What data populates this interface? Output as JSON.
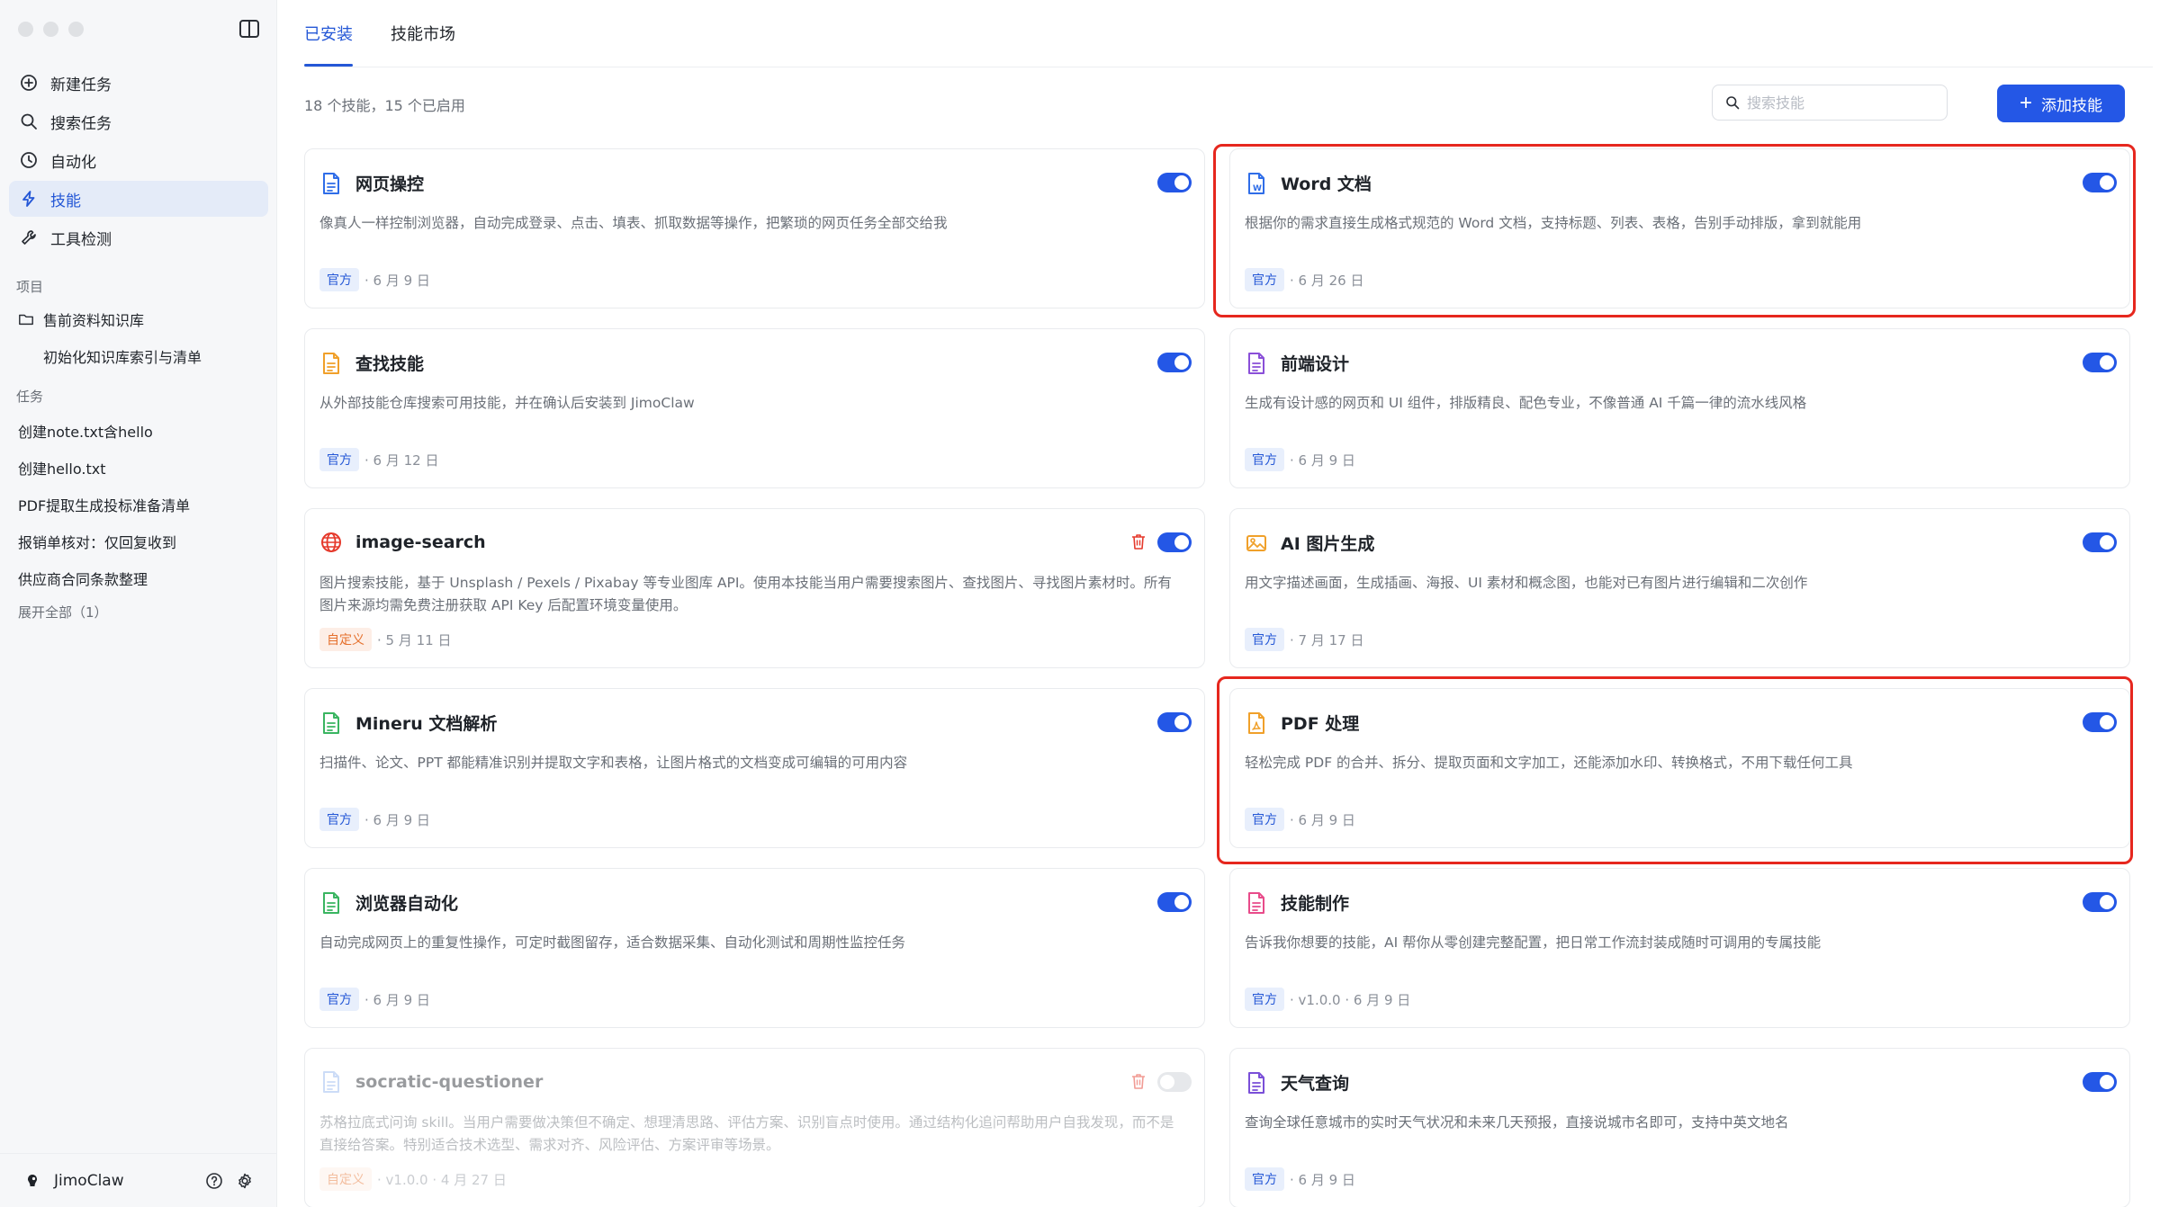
{
  "sidebar": {
    "nav": [
      {
        "label": "新建任务",
        "icon": "plus-circle-icon"
      },
      {
        "label": "搜索任务",
        "icon": "search-icon"
      },
      {
        "label": "自动化",
        "icon": "clock-icon"
      },
      {
        "label": "技能",
        "icon": "lightning-icon"
      },
      {
        "label": "工具检测",
        "icon": "wrench-icon"
      }
    ],
    "projects_label": "项目",
    "projects": [
      {
        "label": "售前资料知识库"
      },
      {
        "label": "初始化知识库索引与清单"
      }
    ],
    "tasks_label": "任务",
    "tasks": [
      {
        "label": "创建note.txt含hello"
      },
      {
        "label": "创建hello.txt"
      },
      {
        "label": "PDF提取生成投标准备清单"
      },
      {
        "label": "报销单核对：仅回复收到"
      },
      {
        "label": "供应商合同条款整理"
      }
    ],
    "expand_all": "展开全部（1）",
    "user_name": "JimoClaw"
  },
  "tabs": [
    {
      "label": "已安装"
    },
    {
      "label": "技能市场"
    }
  ],
  "summary": "18 个技能，15 个已启用",
  "search": {
    "placeholder": "搜索技能"
  },
  "add_button": {
    "label": "添加技能"
  },
  "cards": [
    {
      "title": "网页操控",
      "icon": "document-icon",
      "desc": "像真人一样控制浏览器，自动完成登录、点击、填表、抓取数据等操作，把繁琐的网页任务全部交给我",
      "badge": "官方",
      "meta": "· 6 月 9 日",
      "enabled": true
    },
    {
      "title": "Word 文档",
      "icon": "word-document-icon",
      "desc": "根据你的需求直接生成格式规范的 Word 文档，支持标题、列表、表格，告别手动排版，拿到就能用",
      "badge": "官方",
      "meta": "· 6 月 26 日",
      "enabled": true
    },
    {
      "title": "查找技能",
      "icon": "document-icon",
      "desc": "从外部技能仓库搜索可用技能，并在确认后安装到 JimoClaw",
      "badge": "官方",
      "meta": "· 6 月 12 日",
      "enabled": true
    },
    {
      "title": "前端设计",
      "icon": "document-icon",
      "desc": "生成有设计感的网页和 UI 组件，排版精良、配色专业，不像普通 AI 千篇一律的流水线风格",
      "badge": "官方",
      "meta": "· 6 月 9 日",
      "enabled": true
    },
    {
      "title": "image-search",
      "icon": "globe-icon",
      "desc": "图片搜索技能，基于 Unsplash / Pexels / Pixabay 等专业图库 API。使用本技能当用户需要搜索图片、查找图片、寻找图片素材时。所有图片来源均需免费注册获取 API Key 后配置环境变量使用。",
      "badge": "自定义",
      "meta": "· 5 月 11 日",
      "enabled": true
    },
    {
      "title": "AI 图片生成",
      "icon": "image-icon",
      "desc": "用文字描述画面，生成插画、海报、UI 素材和概念图，也能对已有图片进行编辑和二次创作",
      "badge": "官方",
      "meta": "· 7 月 17 日",
      "enabled": true
    },
    {
      "title": "Mineru 文档解析",
      "icon": "document-icon",
      "desc": "扫描件、论文、PPT 都能精准识别并提取文字和表格，让图片格式的文档变成可编辑的可用内容",
      "badge": "官方",
      "meta": "· 6 月 9 日",
      "enabled": true
    },
    {
      "title": "PDF 处理",
      "icon": "pdf-icon",
      "desc": "轻松完成 PDF 的合并、拆分、提取页面和文字加工，还能添加水印、转换格式，不用下载任何工具",
      "badge": "官方",
      "meta": "· 6 月 9 日",
      "enabled": true
    },
    {
      "title": "浏览器自动化",
      "icon": "document-icon",
      "desc": "自动完成网页上的重复性操作，可定时截图留存，适合数据采集、自动化测试和周期性监控任务",
      "badge": "官方",
      "meta": "· 6 月 9 日",
      "enabled": true
    },
    {
      "title": "技能制作",
      "icon": "document-icon",
      "desc": "告诉我你想要的技能，AI 帮你从零创建完整配置，把日常工作流封装成随时可调用的专属技能",
      "badge": "官方",
      "meta": "· v1.0.0 · 6 月 9 日",
      "enabled": true
    },
    {
      "title": "socratic-questioner",
      "icon": "document-icon",
      "desc": "苏格拉底式问询 skill。当用户需要做决策但不确定、想理清思路、评估方案、识别盲点时使用。通过结构化追问帮助用户自我发现，而不是直接给答案。特别适合技术选型、需求对齐、风险评估、方案评审等场景。",
      "badge": "自定义",
      "meta": "· v1.0.0 · 4 月 27 日",
      "enabled": false
    },
    {
      "title": "天气查询",
      "icon": "document-icon",
      "desc": "查询全球任意城市的实时天气状况和未来几天预报，直接说城市名即可，支持中英文地名",
      "badge": "官方",
      "meta": "· 6 月 9 日",
      "enabled": true
    }
  ],
  "colors": {
    "accent": "#2457e6",
    "highlight": "#e6271e",
    "official_badge_bg": "#e8effc",
    "custom_badge_bg": "#fdeee6"
  }
}
